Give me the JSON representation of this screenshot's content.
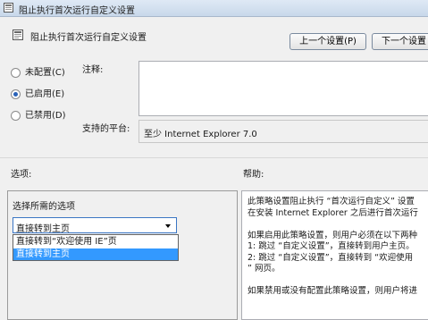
{
  "window": {
    "title": "阻止执行首次运行自定义设置"
  },
  "header": {
    "policy_title": "阻止执行首次运行自定义设置",
    "prev_button": "上一个设置(P)",
    "next_button": "下一个设置"
  },
  "state": {
    "options": [
      {
        "label": "未配置(C)",
        "selected": false
      },
      {
        "label": "已启用(E)",
        "selected": true
      },
      {
        "label": "已禁用(D)",
        "selected": false
      }
    ]
  },
  "fields": {
    "comment_label": "注释:",
    "comment_value": "",
    "supported_label": "支持的平台:",
    "supported_value": "至少 Internet Explorer 7.0"
  },
  "options_panel": {
    "heading": "选项:",
    "prompt": "选择所需的选项",
    "selected_value": "直接转到主页",
    "dropdown_items": [
      {
        "label": "直接转到“欢迎使用 IE”页",
        "highlighted": false
      },
      {
        "label": "直接转到主页",
        "highlighted": true
      }
    ]
  },
  "help_panel": {
    "heading": "帮助:",
    "paragraphs": [
      [
        "此策略设置阻止执行 “首次运行自定义” 设置",
        "在安装 Internet Explorer 之后进行首次运行"
      ],
      [
        "如果启用此策略设置，则用户必须在以下两种",
        "1: 跳过 “自定义设置”，直接转到用户主页。",
        "2: 跳过 “自定义设置”，直接转到 “欢迎使用",
        "” 网页。"
      ],
      [
        "如果禁用或没有配置此策略设置，则用户将进"
      ]
    ]
  }
}
